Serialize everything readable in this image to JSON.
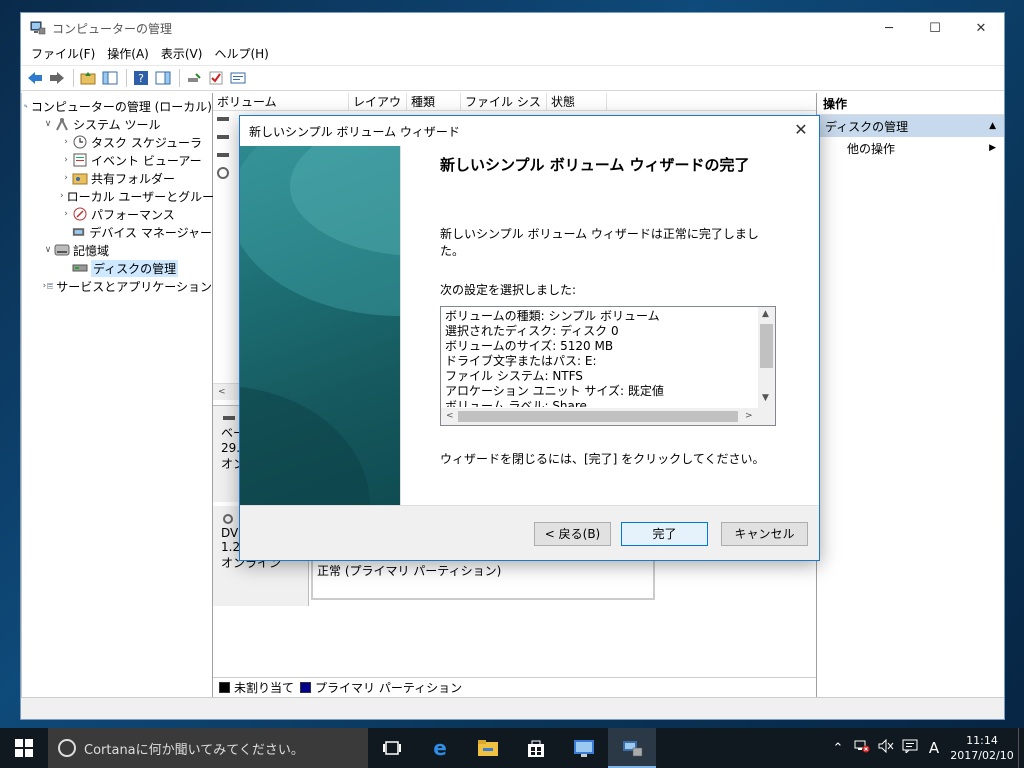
{
  "window": {
    "title": "コンピューターの管理",
    "minimize": "─",
    "maximize": "☐",
    "close": "✕"
  },
  "menu": [
    "ファイル(F)",
    "操作(A)",
    "表示(V)",
    "ヘルプ(H)"
  ],
  "tree": [
    {
      "label": "コンピューターの管理 (ローカル)",
      "level": 0,
      "arrow": ""
    },
    {
      "label": "システム ツール",
      "level": 1,
      "arrow": "v"
    },
    {
      "label": "タスク スケジューラ",
      "level": 2,
      "arrow": ">"
    },
    {
      "label": "イベント ビューアー",
      "level": 2,
      "arrow": ">"
    },
    {
      "label": "共有フォルダー",
      "level": 2,
      "arrow": ">"
    },
    {
      "label": "ローカル ユーザーとグループ",
      "level": 2,
      "arrow": ">"
    },
    {
      "label": "パフォーマンス",
      "level": 2,
      "arrow": ">"
    },
    {
      "label": "デバイス マネージャー",
      "level": 2,
      "arrow": ""
    },
    {
      "label": "記憶域",
      "level": 1,
      "arrow": "v"
    },
    {
      "label": "ディスクの管理",
      "level": 2,
      "arrow": "",
      "selected": true
    },
    {
      "label": "サービスとアプリケーション",
      "level": 1,
      "arrow": ">"
    }
  ],
  "columns": [
    "ボリューム",
    "レイアウト",
    "種類",
    "ファイル システム",
    "状態"
  ],
  "disk_rows": [
    {
      "label_lines": [
        "ベー",
        "29.",
        "オン"
      ]
    },
    {
      "label_lines": [
        "DV",
        "1.2",
        "オンライン"
      ]
    }
  ],
  "partition_status": "正常 (プライマリ パーティション)",
  "legend": [
    {
      "label": "未割り当て",
      "color": "#000000"
    },
    {
      "label": "プライマリ パーティション",
      "color": "#00008b"
    }
  ],
  "actions": {
    "header": "操作",
    "section": "ディスクの管理",
    "item": "他の操作"
  },
  "dialog": {
    "title": "新しいシンプル ボリューム ウィザード",
    "heading": "新しいシンプル ボリューム ウィザードの完了",
    "completed_text": "新しいシンプル ボリューム ウィザードは正常に完了しました。",
    "selected_label": "次の設定を選択しました:",
    "settings": [
      "ボリュームの種類: シンプル ボリューム",
      "選択されたディスク: ディスク 0",
      "ボリュームのサイズ: 5120 MB",
      "ドライブ文字またはパス: E:",
      "ファイル システム: NTFS",
      "アロケーション ユニット サイズ: 既定値",
      "ボリューム ラベル: Share"
    ],
    "close_text": "ウィザードを閉じるには、[完了] をクリックしてください。",
    "back_button": "< 戻る(B)",
    "finish_button": "完了",
    "cancel_button": "キャンセル"
  },
  "taskbar": {
    "search_placeholder": "Cortanaに何か聞いてみてください。",
    "ime": "A",
    "time": "11:14",
    "date": "2017/02/10"
  },
  "colors": {
    "accent": "#0078d7",
    "selection": "#cde8ff",
    "wizard_side": "#1d6f74"
  }
}
